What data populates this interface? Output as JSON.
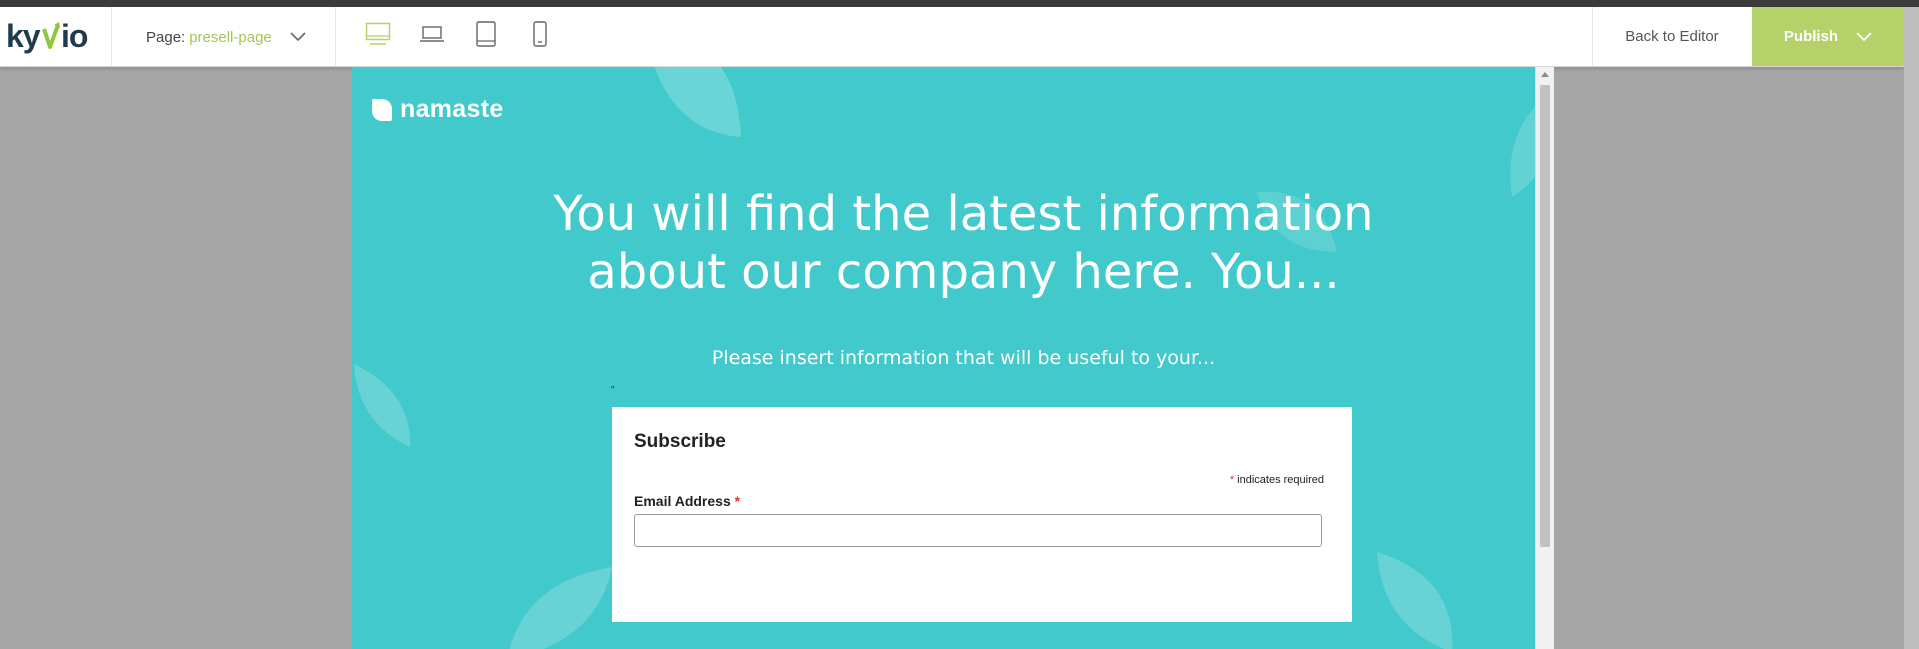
{
  "toolbar": {
    "logo_text": "kyvio",
    "page_prefix": "Page:",
    "page_name": "presell-page",
    "devices": [
      {
        "name": "desktop",
        "icon": "desktop-icon",
        "active": true
      },
      {
        "name": "laptop",
        "icon": "laptop-icon",
        "active": false
      },
      {
        "name": "tablet",
        "icon": "tablet-icon",
        "active": false
      },
      {
        "name": "mobile",
        "icon": "mobile-icon",
        "active": false
      }
    ],
    "back_label": "Back to Editor",
    "publish_label": "Publish"
  },
  "preview": {
    "brand_name": "namaste",
    "headline": "You will find the latest information about our company here. You...",
    "subline": "Please insert information that will be useful to your...",
    "stray_mark": "\"",
    "form": {
      "title": "Subscribe",
      "required_star": "*",
      "required_note": "indicates required",
      "email_label": "Email Address",
      "email_value": ""
    }
  },
  "colors": {
    "accent": "#a3c64f",
    "publish_bg": "#b5d26a",
    "preview_bg": "#41c9cb",
    "required": "#e0352b"
  }
}
